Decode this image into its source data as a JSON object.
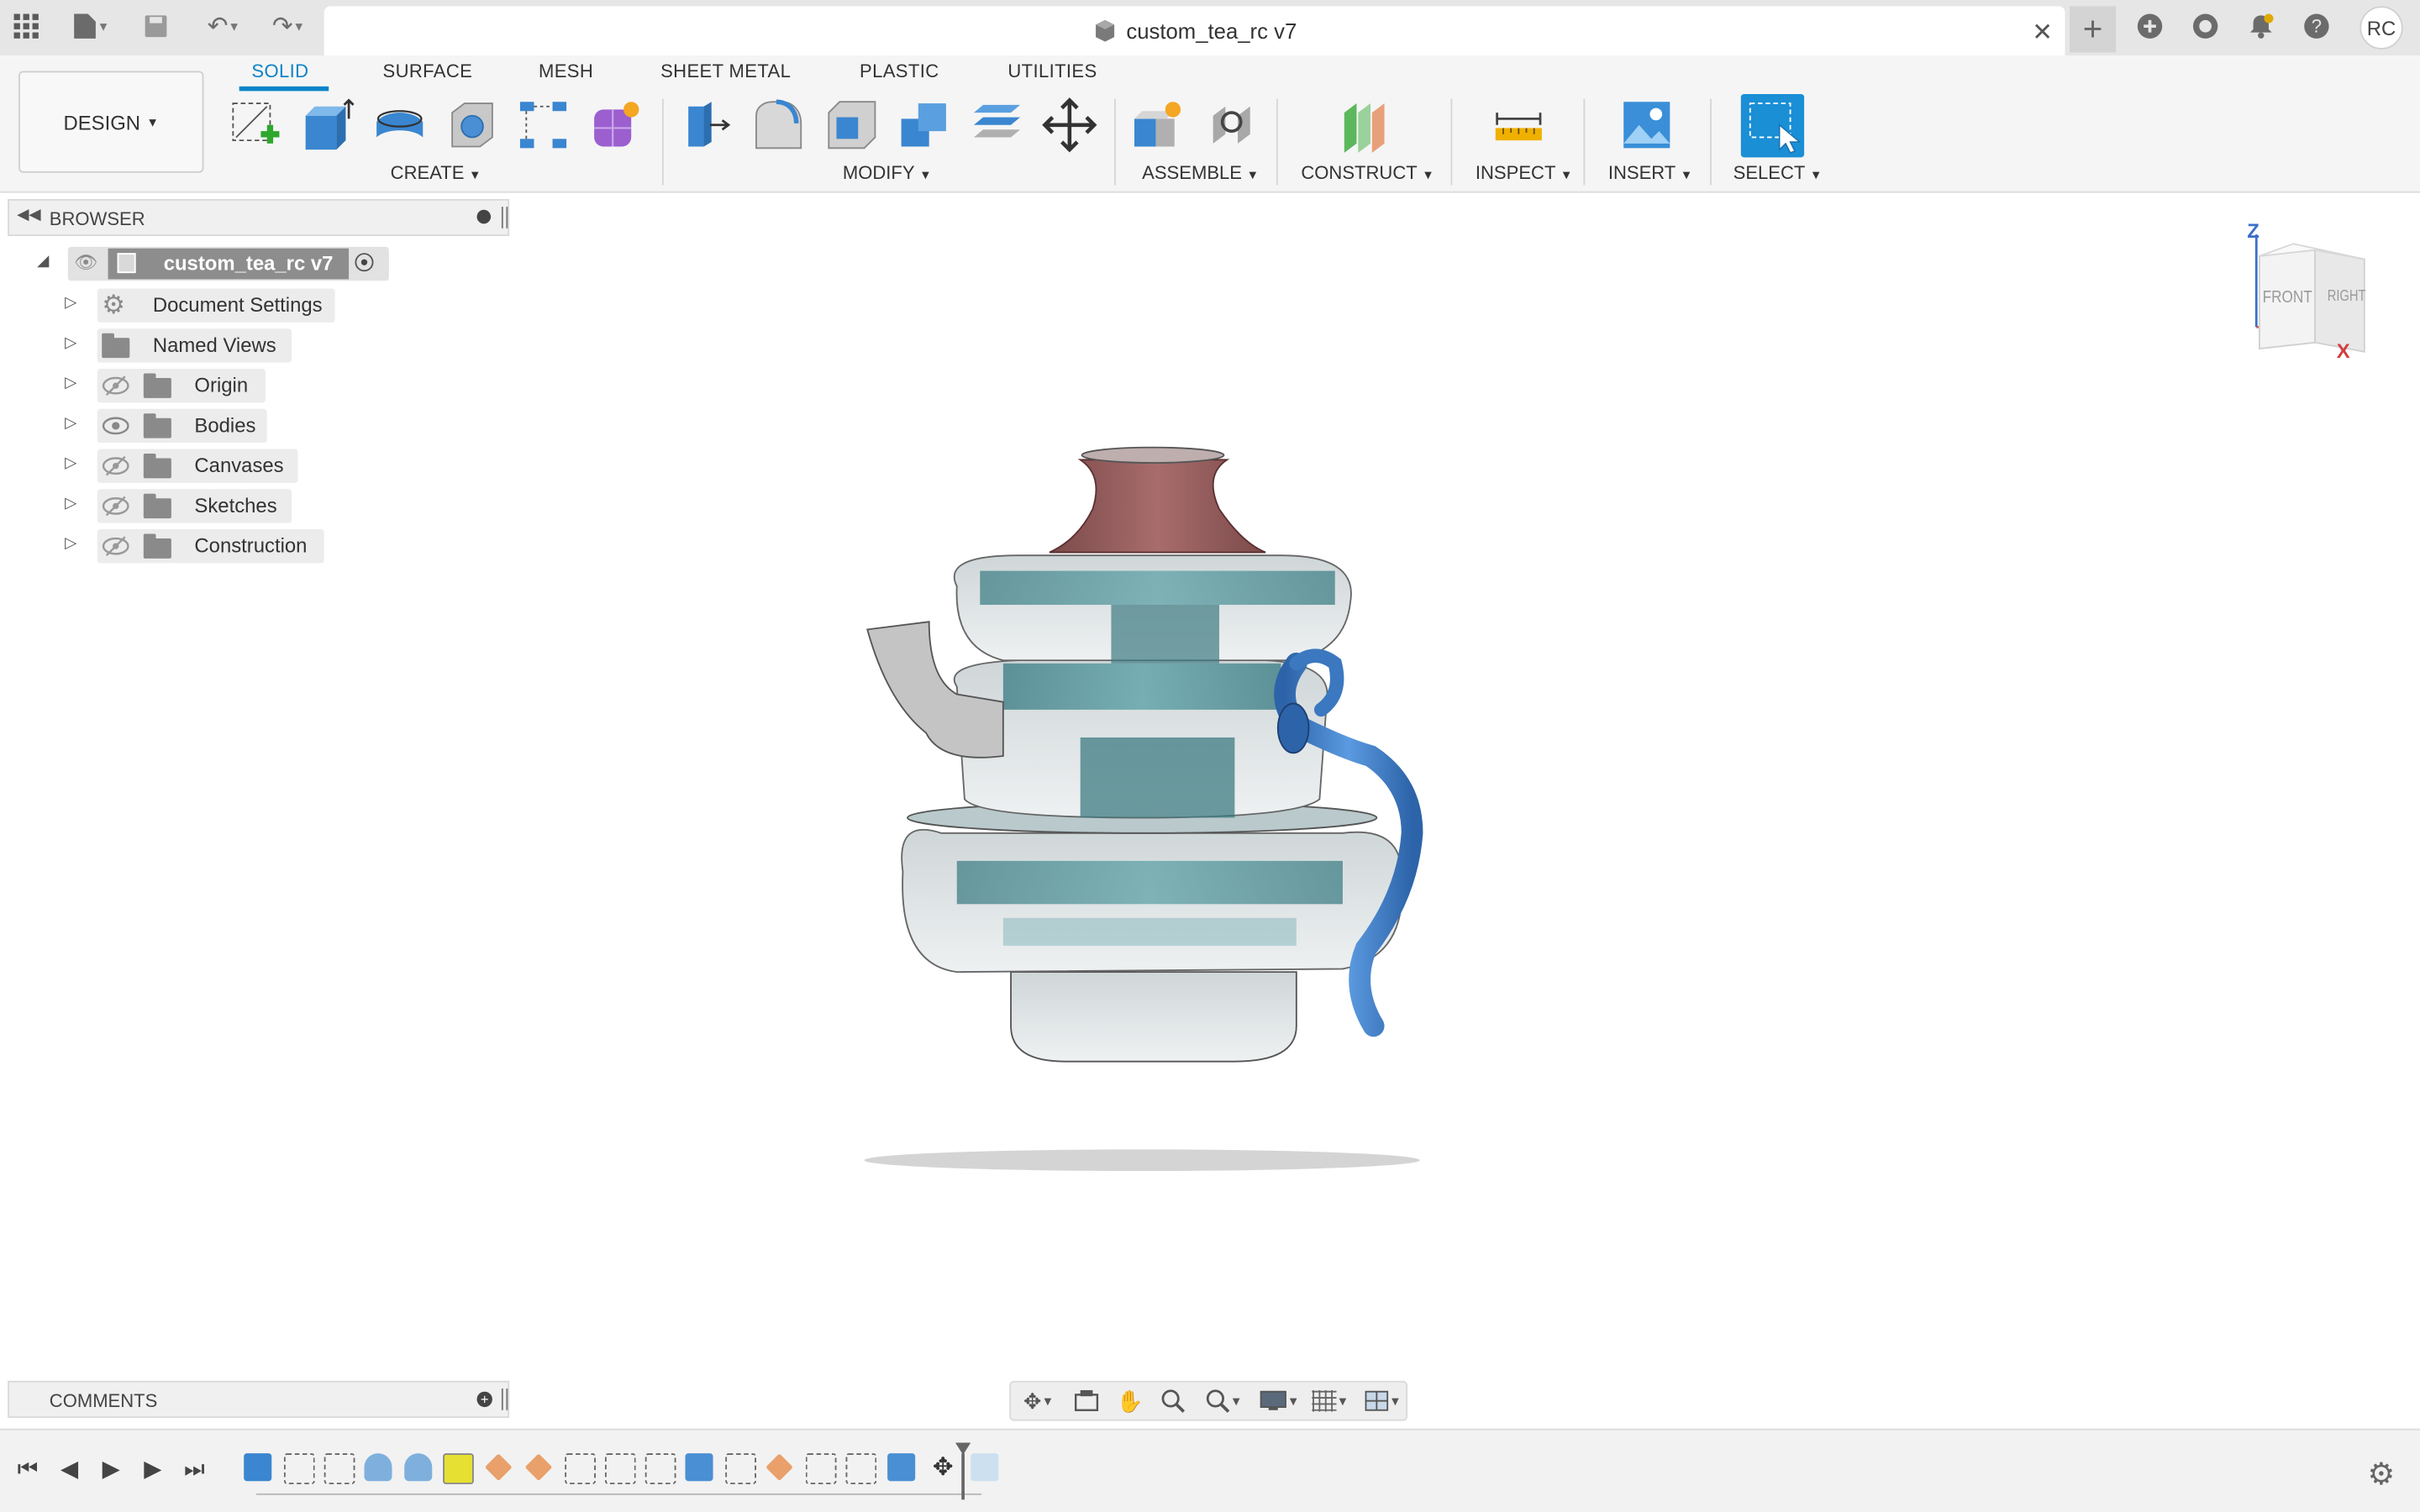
{
  "titlebar": {
    "document_title": "custom_tea_rc v7",
    "user_initials": "RC"
  },
  "toolbar": {
    "workspace_button": "DESIGN",
    "tabs": [
      "SOLID",
      "SURFACE",
      "MESH",
      "SHEET METAL",
      "PLASTIC",
      "UTILITIES"
    ],
    "active_tab": "SOLID",
    "groups": {
      "create": "CREATE",
      "modify": "MODIFY",
      "assemble": "ASSEMBLE",
      "construct": "CONSTRUCT",
      "inspect": "INSPECT",
      "insert": "INSERT",
      "select": "SELECT"
    }
  },
  "browser": {
    "title": "BROWSER",
    "root": "custom_tea_rc v7",
    "items": [
      {
        "label": "Document Settings",
        "icon": "gear-icon",
        "visibility": "none"
      },
      {
        "label": "Named Views",
        "icon": "folder-icon",
        "visibility": "none"
      },
      {
        "label": "Origin",
        "icon": "folder-icon",
        "visibility": "hidden"
      },
      {
        "label": "Bodies",
        "icon": "folder-icon",
        "visibility": "visible"
      },
      {
        "label": "Canvases",
        "icon": "folder-icon",
        "visibility": "hidden"
      },
      {
        "label": "Sketches",
        "icon": "folder-icon",
        "visibility": "hidden"
      },
      {
        "label": "Construction",
        "icon": "folder-icon",
        "visibility": "hidden"
      }
    ]
  },
  "viewcube": {
    "front": "FRONT",
    "right": "RIGHT",
    "axis_z": "Z",
    "axis_x": "X"
  },
  "comments": {
    "label": "COMMENTS"
  },
  "colors": {
    "accent": "#0a84c8",
    "select_tool": "#1a8fd6",
    "teapot_handle": "#3b78c0",
    "teapot_lid": "#9c5a5a",
    "teapot_glass": "#5e9ea0"
  }
}
